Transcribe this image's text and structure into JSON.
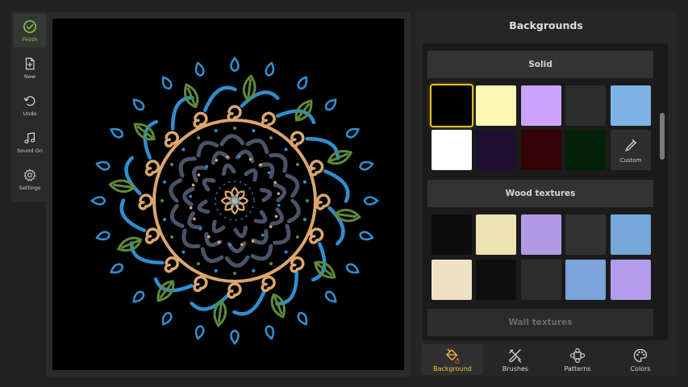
{
  "toolbar": {
    "items": [
      {
        "label": "Finish",
        "icon": "check-circle-icon",
        "active": true
      },
      {
        "label": "New",
        "icon": "file-plus-icon"
      },
      {
        "label": "Undo",
        "icon": "undo-icon"
      },
      {
        "label": "Sound On",
        "icon": "music-note-icon"
      },
      {
        "label": "Settings",
        "icon": "gear-icon"
      }
    ]
  },
  "panel": {
    "title": "Backgrounds",
    "sections": [
      {
        "title": "Solid",
        "swatches": [
          "#000000",
          "#fbf7b6",
          "#cca2fb",
          "#2d2d2d",
          "#7fb3e6",
          "#ffffff",
          "#1e0f33",
          "#330307",
          "#032108"
        ],
        "selected_index": 0,
        "custom_label": "Custom"
      },
      {
        "title": "Wood textures",
        "swatches": [
          "#0d0d0d",
          "#eee2b2",
          "#b09ae4",
          "#323232",
          "#77a6d8",
          "#f0e0c4",
          "#0f0f0f",
          "#2c2c2c",
          "#7aa4da",
          "#b49cec"
        ]
      },
      {
        "title": "Wall textures"
      }
    ]
  },
  "tabs": [
    {
      "label": "Background",
      "icon": "paint-bucket-icon",
      "active": true
    },
    {
      "label": "Brushes",
      "icon": "brush-icon"
    },
    {
      "label": "Patterns",
      "icon": "pattern-icon"
    },
    {
      "label": "Colors",
      "icon": "palette-icon"
    }
  ],
  "colors": {
    "accent_green": "#8fd14f",
    "accent_gold": "#f0c23a",
    "selection_border": "#e6c021",
    "mandala_blue": "#2e8fd0",
    "mandala_green": "#5f8a3a",
    "mandala_tan": "#d9a66e",
    "mandala_slate": "#4a5366"
  }
}
